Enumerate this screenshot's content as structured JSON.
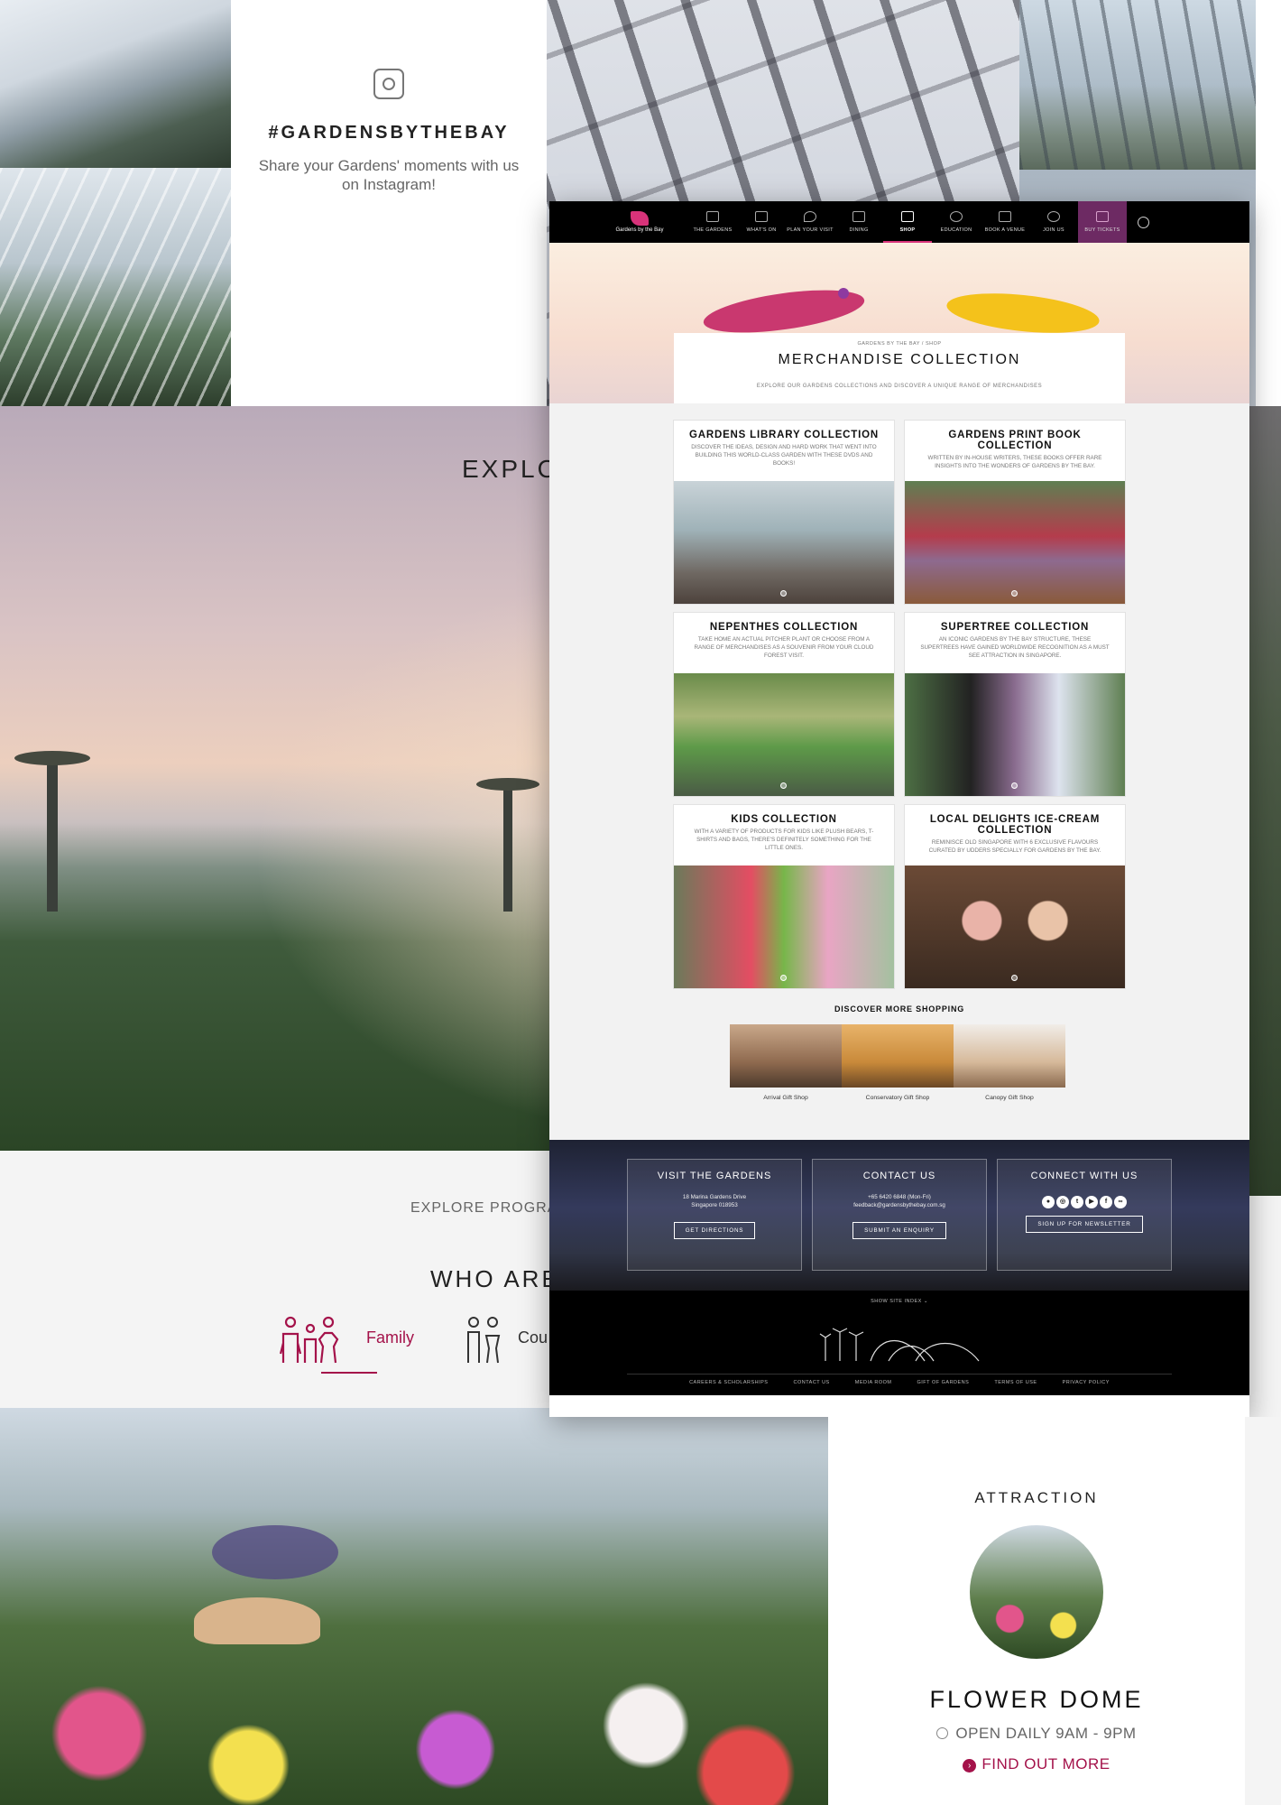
{
  "instagram": {
    "hashtag": "#GARDENSBYTHEBAY",
    "subtitle": "Share your Gardens' moments with us on Instagram!"
  },
  "explore": {
    "heading_fragment": "EXPLO",
    "programmes_fragment": "EXPLORE PROGRAM",
    "who_are_fragment": "WHO ARE"
  },
  "audience": {
    "family_label": "Family",
    "couple_fragment": "Cou"
  },
  "shop_page": {
    "nav": {
      "logo_text": "Gardens by the Bay",
      "items": [
        "THE GARDENS",
        "WHAT'S ON",
        "PLAN YOUR VISIT",
        "DINING",
        "SHOP",
        "EDUCATION",
        "BOOK A VENUE",
        "JOIN US"
      ],
      "active": "SHOP",
      "buy_tickets": "BUY TICKETS"
    },
    "breadcrumb": "GARDENS BY THE BAY  /  SHOP",
    "title": "MERCHANDISE COLLECTION",
    "subtitle": "EXPLORE OUR GARDENS COLLECTIONS AND DISCOVER A UNIQUE RANGE OF MERCHANDISES",
    "collections": [
      {
        "title": "GARDENS LIBRARY COLLECTION",
        "desc": "Discover the ideas, design and hard work that went into building this world-class garden with these DVDs and books!"
      },
      {
        "title": "GARDENS PRINT BOOK COLLECTION",
        "desc": "Written by in-house writers, these books offer rare insights into the wonders of Gardens by the Bay."
      },
      {
        "title": "NEPENTHES COLLECTION",
        "desc": "Take home an actual pitcher plant or choose from a range of merchandises as a souvenir from your Cloud Forest visit."
      },
      {
        "title": "SUPERTREE COLLECTION",
        "desc": "An iconic Gardens by the Bay structure, these Supertrees have gained worldwide recognition as a must see attraction in Singapore."
      },
      {
        "title": "KIDS COLLECTION",
        "desc": "With a variety of products for kids like plush bears, t-shirts and bags, there's definitely something for the little ones."
      },
      {
        "title": "LOCAL DELIGHTS ICE-CREAM COLLECTION",
        "desc": "Reminisce old Singapore with 6 exclusive flavours curated by Udders specially for Gardens by the Bay."
      }
    ],
    "discover_more": "DISCOVER MORE SHOPPING",
    "stores": [
      "Arrival Gift Shop",
      "Conservatory Gift Shop",
      "Canopy Gift Shop"
    ],
    "footer": {
      "visit": {
        "title": "VISIT THE GARDENS",
        "address1": "18 Marina Gardens Drive",
        "address2": "Singapore 018953",
        "button": "GET DIRECTIONS"
      },
      "contact": {
        "title": "CONTACT US",
        "phone": "+65 6420 6848 (Mon-Fri)",
        "email": "feedback@gardensbythebay.com.sg",
        "button": "SUBMIT AN ENQUIRY"
      },
      "connect": {
        "title": "CONNECT WITH US",
        "button": "SIGN UP FOR NEWSLETTER",
        "social_icons": [
          "flickr-icon",
          "instagram-icon",
          "twitter-icon",
          "youtube-icon",
          "facebook-icon",
          "tripadvisor-icon"
        ]
      },
      "site_index": "SHOW SITE INDEX",
      "links": [
        "CAREERS & SCHOLARSHIPS",
        "CONTACT US",
        "MEDIA ROOM",
        "GIFT OF GARDENS",
        "TERMS OF USE",
        "PRIVACY POLICY"
      ]
    }
  },
  "attraction": {
    "label": "ATTRACTION",
    "name": "FLOWER DOME",
    "hours": "OPEN DAILY 9AM - 9PM",
    "link": "FIND OUT MORE"
  },
  "colors": {
    "accent": "#a4124a",
    "nav_bg": "#000000",
    "buy_tickets_bg": "#6d2a63"
  }
}
